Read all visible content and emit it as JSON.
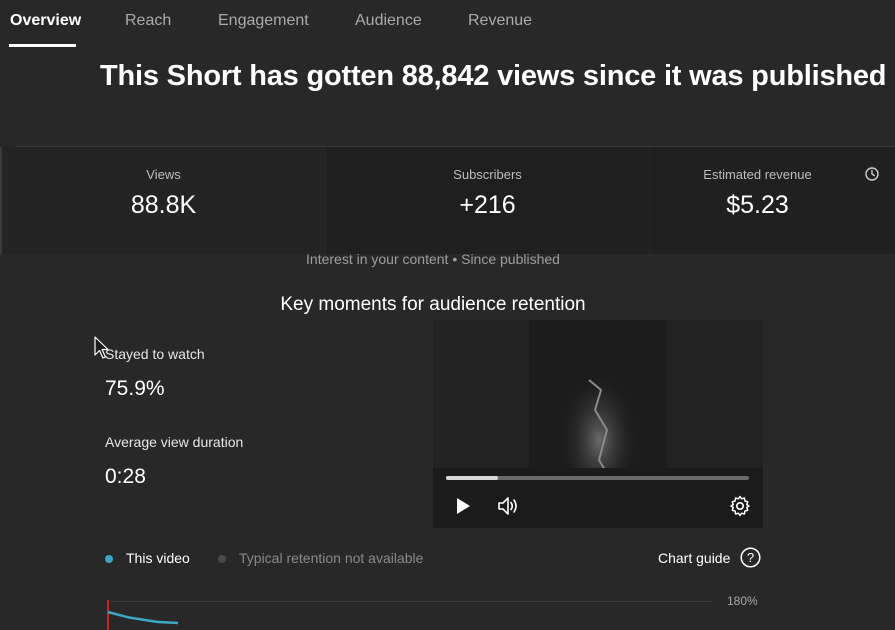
{
  "tabs": [
    {
      "label": "Overview",
      "active": true
    },
    {
      "label": "Reach",
      "active": false
    },
    {
      "label": "Engagement",
      "active": false
    },
    {
      "label": "Audience",
      "active": false
    },
    {
      "label": "Revenue",
      "active": false
    }
  ],
  "headline": "This Short has gotten 88,842 views since it was published",
  "stats": {
    "views": {
      "label": "Views",
      "value": "88.8K"
    },
    "subscribers": {
      "label": "Subscribers",
      "value": "+216"
    },
    "revenue": {
      "label": "Estimated revenue",
      "value": "$5.23",
      "icon": "clock-icon"
    }
  },
  "interest_caption": "Interest in your content • Since published",
  "key_moments": {
    "title": "Key moments for audience retention",
    "stayed_label": "Stayed to watch",
    "stayed_value": "75.9%",
    "avd_label": "Average view duration",
    "avd_value": "0:28"
  },
  "player": {
    "progress_fraction": 0.17,
    "icons": [
      "play-icon",
      "volume-icon",
      "settings-gear-icon"
    ]
  },
  "legend": {
    "this_video": "This video",
    "typical": "Typical retention not available",
    "this_video_color": "#3ea6c4",
    "typical_color": "#4a4a4a"
  },
  "chart_guide": "Chart guide",
  "chart_data": {
    "type": "line",
    "ytick_top": "180%",
    "series": [
      {
        "name": "This video",
        "color": "#3ea6c4",
        "points": [
          [
            0,
            160
          ],
          [
            0.3,
            150
          ],
          [
            0.7,
            142
          ],
          [
            1,
            140
          ]
        ]
      }
    ],
    "ylim": [
      0,
      180
    ]
  },
  "colors": {
    "background": "#282828",
    "accent_line": "#3ea6c4",
    "marker_red": "#cc2222"
  }
}
